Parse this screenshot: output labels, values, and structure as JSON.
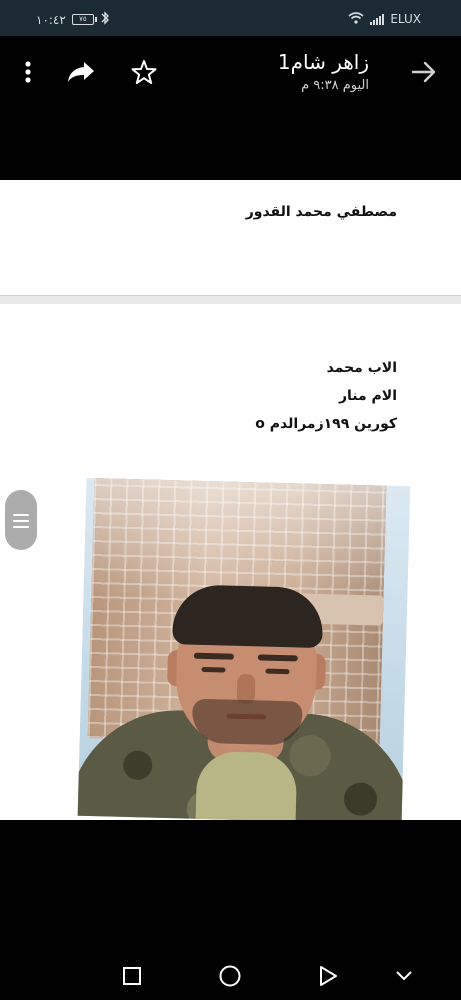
{
  "status_bar": {
    "time": "١٠:٤٢",
    "battery": "٧٥",
    "carrier": "ELUX"
  },
  "header": {
    "title": "زاهر شام1",
    "subtitle": "اليوم ٩:٣٨ م",
    "icons": [
      "more-vert-icon",
      "share-icon",
      "star-icon",
      "arrow-forward-icon"
    ]
  },
  "messages": {
    "name": "مصطفي محمد القدور",
    "info_lines": [
      "الاب محمد",
      "الام منار",
      "كورين ١٩٩زمرالدم o"
    ]
  },
  "nav": {
    "icons": [
      "recent-apps-icon",
      "home-icon",
      "back-icon",
      "hide-nav-icon"
    ]
  },
  "colors": {
    "status_bar_bg": "#1b2a33",
    "header_bg": "#000000",
    "card_bg": "#ffffff"
  }
}
